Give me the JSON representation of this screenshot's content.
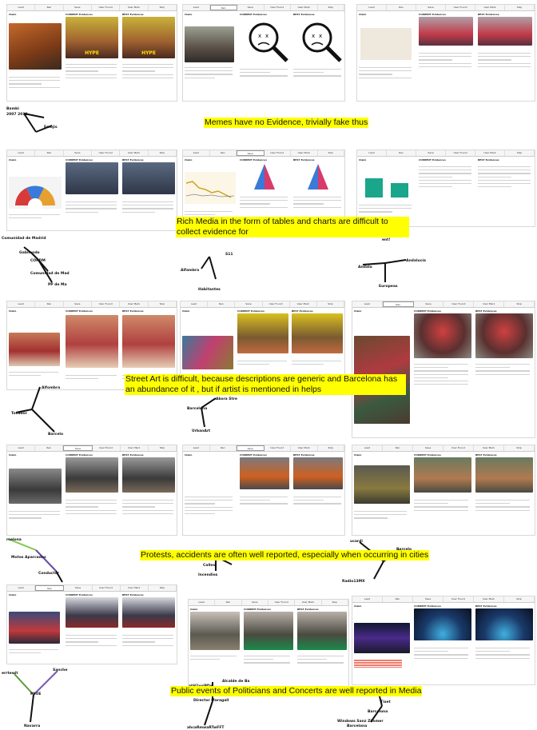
{
  "tabs": [
    "Lead",
    "Ren",
    "Save",
    "User Found",
    "User Mark",
    "Skip"
  ],
  "labels": {
    "claim": "Claim",
    "current": "CURRENT Evidences",
    "best": "BEST Evidences",
    "hype": "HYPE"
  },
  "captions": {
    "memes": "Memes have no Evidence, trivially fake thus",
    "rich_media": "Rich Media in the form of tables and charts are difficult to collect evidence for",
    "street_art": "Street Art is difficult, because descriptions are generic and Barcelona has an abundance of it , but if artist is mentioned in helps",
    "protests": "Protests, accidents are often well reported, especially when occurring in cities",
    "politicians": "Public events of Politicians and Concerts are well reported in Media"
  },
  "graph_labels": {
    "row1": [
      "2007 2019",
      "Bambi",
      "Emojis"
    ],
    "row2a": [
      "Comunidad de Madrid",
      "Gabilondo",
      "CORDM",
      "Comunidad de Mad",
      "PP de Ma"
    ],
    "row2b": [
      "Alfambra",
      "Habitantes",
      "S11"
    ],
    "row2c": [
      "Europeas",
      "Andalucía",
      "Andalu",
      "ent!"
    ],
    "row3a": [
      "Alfombra",
      "Tocador",
      "Barcelo",
      "Barcelona"
    ],
    "row3b": [
      "Barcelona",
      "UrbanArt",
      "Akora Stre"
    ],
    "row4a": [
      "rcelona",
      "Motos Aparcadas",
      "Conductor"
    ],
    "row4b": [
      "Barcelona",
      "Calles",
      "Incendios",
      "Tomas"
    ],
    "row4c": [
      "ucardi",
      "Barcelo",
      "Radio13MX"
    ],
    "row5a": [
      "errtewit",
      "Sanche",
      "PSOE",
      "Navarra"
    ],
    "row5b": [
      "Alcalde de Ba",
      "Director Maragall",
      "atH2xoiPDx",
      "ahcaRmwaRTwFFT"
    ],
    "row5c": [
      "Barcelona",
      "Tixet",
      "Windows Sanz Zimmer",
      "Barcelona"
    ]
  }
}
